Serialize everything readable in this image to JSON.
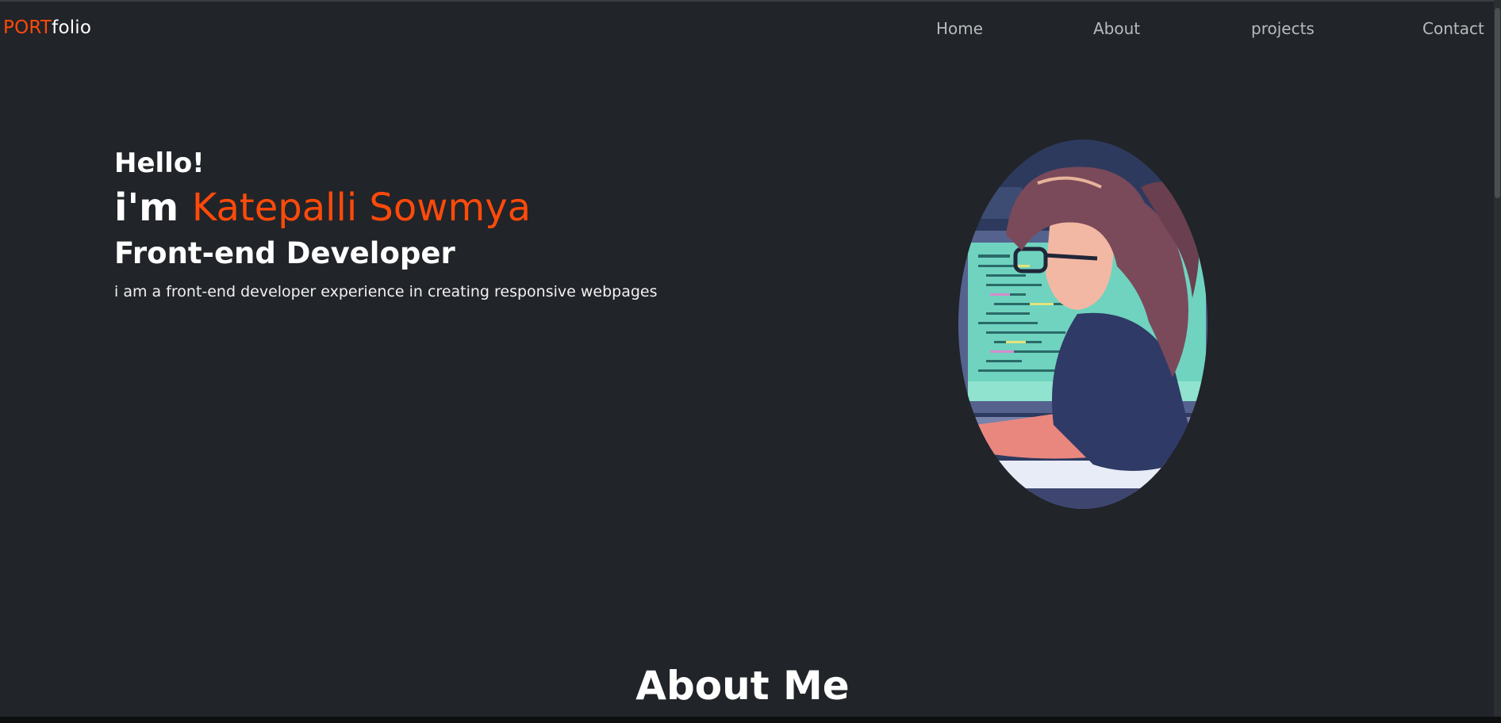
{
  "header": {
    "logo_port": "PORT",
    "logo_folio": "folio",
    "nav": {
      "home": "Home",
      "about": "About",
      "projects": "projects",
      "contact": "Contact"
    }
  },
  "hero": {
    "greeting": "Hello!",
    "intro_prefix": "i'm ",
    "name": "Katepalli Sowmya",
    "role": "Front-end Developer",
    "description": "i am a front-end developer experience in creating responsive webpages"
  },
  "about": {
    "title": "About Me"
  },
  "colors": {
    "background": "#212428",
    "accent": "#ff4a0a",
    "nav_text": "#b8babd",
    "text": "#ffffff"
  }
}
